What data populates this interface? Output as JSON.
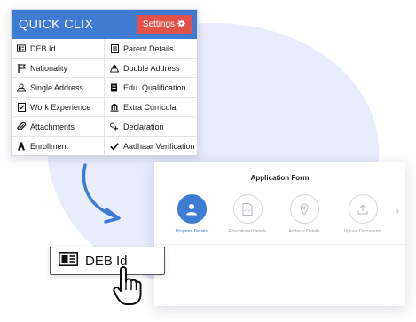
{
  "quick_clix": {
    "title": "QUICK CLIX",
    "settings_label": "Settings",
    "items": [
      {
        "label": "DEB Id",
        "icon": "id-card-icon"
      },
      {
        "label": "Parent Details",
        "icon": "document-icon"
      },
      {
        "label": "Nationality",
        "icon": "flag-icon"
      },
      {
        "label": "Double Address",
        "icon": "double-address-icon"
      },
      {
        "label": "Single Address",
        "icon": "address-icon"
      },
      {
        "label": "Edu. Qualification",
        "icon": "qualification-icon"
      },
      {
        "label": "Work Experience",
        "icon": "checklist-icon"
      },
      {
        "label": "Extra Curricular",
        "icon": "bank-icon"
      },
      {
        "label": "Attachments",
        "icon": "paperclip-icon"
      },
      {
        "label": "Declaration",
        "icon": "declaration-icon"
      },
      {
        "label": "Enrollment",
        "icon": "enrollment-icon"
      },
      {
        "label": "Aadhaar Verification",
        "icon": "check-icon"
      }
    ]
  },
  "application_form": {
    "title": "Application Form",
    "steps": [
      {
        "label": "Program Details",
        "icon": "user-icon",
        "active": true
      },
      {
        "label": "Educational Details",
        "icon": "pdf-icon",
        "active": false
      },
      {
        "label": "Address Details",
        "icon": "location-pin-icon",
        "active": false
      },
      {
        "label": "Upload Documents",
        "icon": "upload-icon",
        "active": false
      }
    ]
  },
  "callout": {
    "label": "DEB Id"
  },
  "colors": {
    "primary": "#3e7cd4",
    "settings": "#e0524a",
    "blob": "#e9ecfb"
  }
}
